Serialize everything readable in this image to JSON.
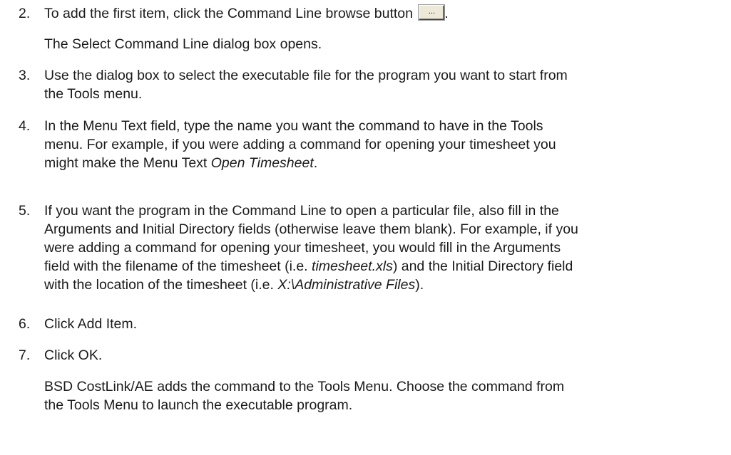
{
  "steps": [
    {
      "number": "2.",
      "line_a": "To add the first item, click the Command Line browse button ",
      "button_label": "...",
      "line_b": ".",
      "note": "The Select Command Line dialog box opens."
    },
    {
      "number": "3.",
      "l1": "Use the dialog box to select the executable file for the program you want to start from",
      "l2": "the Tools menu."
    },
    {
      "number": "4.",
      "l1": "In the Menu Text field, type the name you want the command to have in the Tools",
      "l2": "menu. For example, if you were adding a command for opening your timesheet you",
      "l3_prefix": "might make the Menu Text ",
      "l3_em": "Open Timesheet",
      "l3_suffix": "."
    },
    {
      "number": "5.",
      "l1": "If you want the program in the Command Line to open a particular file, also fill in the",
      "l2": "Arguments and Initial Directory fields (otherwise leave them blank). For example, if you",
      "l3": "were adding a command for opening your timesheet, you would fill in the Arguments",
      "l4_prefix": "field with the filename of the timesheet (i.e. ",
      "l4_em": "timesheet.xls",
      "l4_suffix": ") and the Initial Directory field",
      "l5_prefix": "with the location of the timesheet (i.e. ",
      "l5_em": "X:\\Administrative Files",
      "l5_suffix": ")."
    },
    {
      "number": "6.",
      "l1": "Click Add Item."
    },
    {
      "number": "7.",
      "l1": "Click OK.",
      "note_l1": "BSD CostLink/AE adds the command to the Tools Menu. Choose the command from",
      "note_l2": "the Tools Menu to launch the executable program."
    }
  ]
}
